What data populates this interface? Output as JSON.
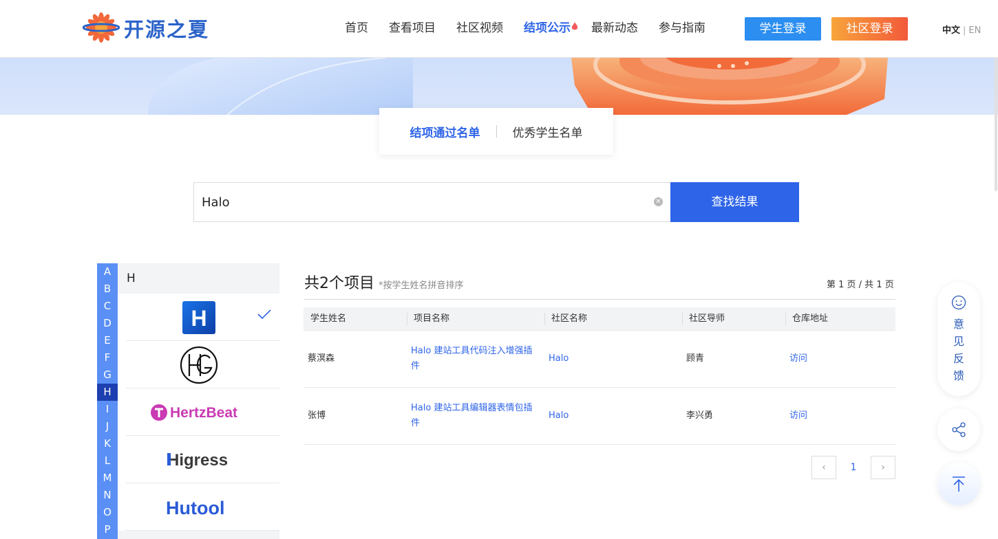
{
  "header": {
    "logo_text": "开源之夏",
    "nav": [
      "首页",
      "查看项目",
      "社区视频",
      "结项公示",
      "最新动态",
      "参与指南"
    ],
    "active_nav": "结项公示",
    "student_login": "学生登录",
    "community_login": "社区登录",
    "lang_zh": "中文",
    "lang_sep": "|",
    "lang_en": "EN",
    "colors": {
      "primary": "#2e64e8",
      "student_button": "#2b8ef0",
      "community_button_from": "#f7a43b",
      "community_button_to": "#f25a3a"
    }
  },
  "tabs": {
    "passed": "结项通过名单",
    "excellent": "优秀学生名单",
    "active": "结项通过名单"
  },
  "search": {
    "value": "Halo",
    "button": "查找结果",
    "clear_icon": "clear-icon"
  },
  "letters": [
    "A",
    "B",
    "C",
    "D",
    "E",
    "F",
    "G",
    "H",
    "I",
    "J",
    "K",
    "L",
    "M",
    "N",
    "O",
    "P"
  ],
  "active_letter": "H",
  "community": {
    "heading": "H",
    "items": [
      {
        "name": "Halo",
        "logo": "halo-logo",
        "logo_text": "H",
        "selected": true
      },
      {
        "name": "HG",
        "logo": "hg-logo",
        "selected": false
      },
      {
        "name": "HertzBeat",
        "logo": "hertzbeat-logo",
        "logo_text": "HertzBeat",
        "selected": false
      },
      {
        "name": "Higress",
        "logo": "higress-logo",
        "logo_text": "Higress",
        "selected": false
      },
      {
        "name": "Hutool",
        "logo": "hutool-logo",
        "logo_text": "Hutool",
        "selected": false
      }
    ]
  },
  "results": {
    "title": "共2个项目",
    "note": "*按学生姓名拼音排序",
    "page_info": "第 1 页 / 共 1 页",
    "columns": [
      "学生姓名",
      "项目名称",
      "社区名称",
      "社区导师",
      "仓库地址"
    ],
    "rows": [
      {
        "student": "蔡溟森",
        "project": "Halo 建站工具代码注入增强插件",
        "community": "Halo",
        "mentor": "顾青",
        "repo": "访问"
      },
      {
        "student": "张博",
        "project": "Halo 建站工具编辑器表情包插件",
        "community": "Halo",
        "mentor": "李兴勇",
        "repo": "访问"
      }
    ],
    "pagination": {
      "current": "1",
      "prev_icon": "chevron-left-icon",
      "next_icon": "chevron-right-icon"
    }
  },
  "floating": {
    "feedback": [
      "意",
      "见",
      "反",
      "馈"
    ],
    "feedback_icon": "smile-icon",
    "share_icon": "share-icon",
    "top_icon": "back-to-top-icon"
  }
}
